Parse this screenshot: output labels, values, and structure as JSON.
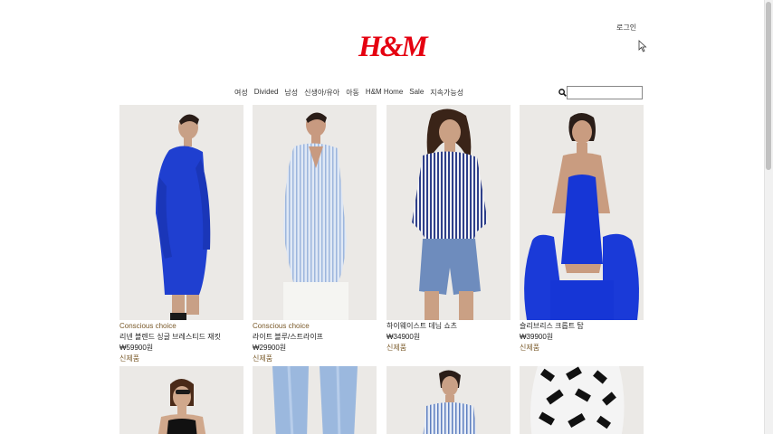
{
  "header": {
    "login_label": "로그인",
    "logo_text": "H&M",
    "brand_color": "#e50010"
  },
  "nav": {
    "items": [
      {
        "label": "여성"
      },
      {
        "label": "Divided"
      },
      {
        "label": "남성"
      },
      {
        "label": "신생아/유아"
      },
      {
        "label": "아동"
      },
      {
        "label": "H&M Home"
      },
      {
        "label": "Sale"
      },
      {
        "label": "지속가능성"
      }
    ]
  },
  "search": {
    "icon": "search-icon",
    "value": "",
    "placeholder": ""
  },
  "products": [
    {
      "label": "Conscious choice",
      "name": "리넨 블렌드 싱글 브레스티드 재킷",
      "price": "₩59900원",
      "badge": "신제품"
    },
    {
      "label": "Conscious choice",
      "name": "라이트 블루/스트라이프",
      "price": "₩29900원",
      "badge": "신제품"
    },
    {
      "label": "",
      "name": "하이웨이스트 데님 쇼츠",
      "price": "₩34900원",
      "badge": "신제품"
    },
    {
      "label": "",
      "name": "슬리브리스 크롭트 탑",
      "price": "₩39900원",
      "badge": "신제품"
    }
  ]
}
